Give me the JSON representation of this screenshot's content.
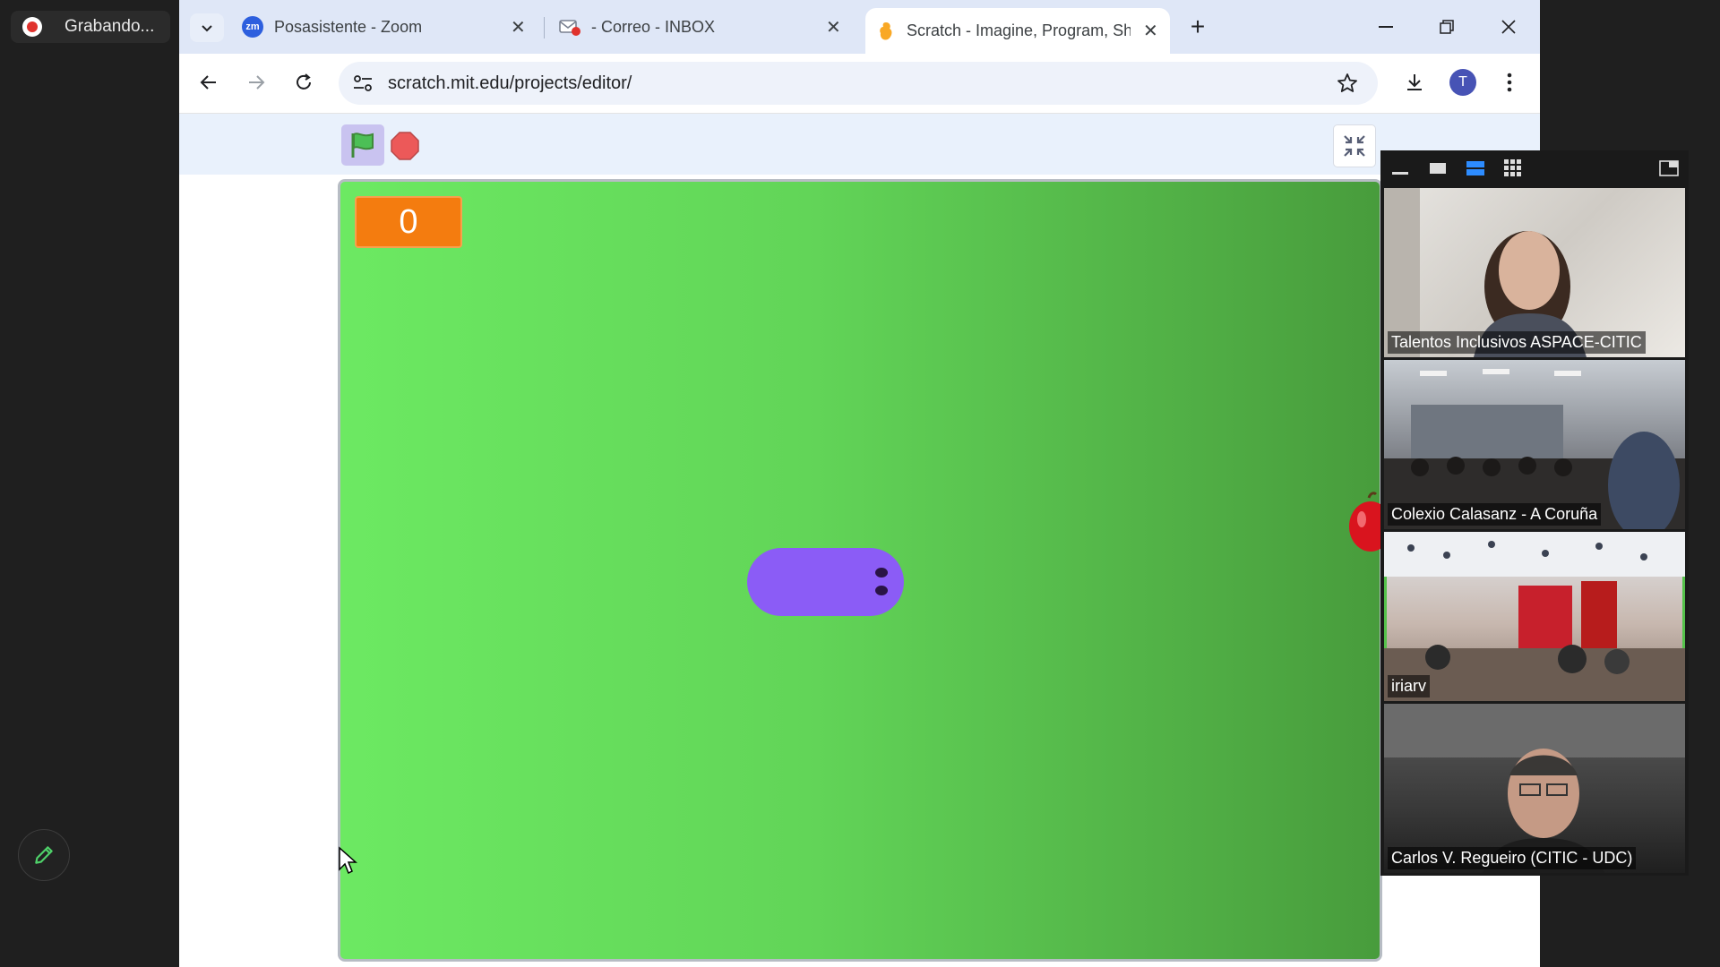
{
  "recording": {
    "label": "Grabando..."
  },
  "browser": {
    "tabs": [
      {
        "title": "Posasistente - Zoom",
        "icon": "zoom-icon",
        "active": false
      },
      {
        "title": "- Correo - INBOX",
        "icon": "mail-icon",
        "active": false
      },
      {
        "title": "Scratch - Imagine, Program, Sha",
        "icon": "scratch-icon",
        "active": true
      }
    ],
    "address": {
      "url": "scratch.mit.edu/projects/editor/"
    },
    "profile_initial": "T"
  },
  "scratch": {
    "score": "0",
    "colors": {
      "stage_green": "#62d558",
      "snake": "#8b5cf6",
      "score_bg": "#f47c0f"
    }
  },
  "zoom": {
    "participants": [
      {
        "name": "Talentos Inclusivos ASPACE-CITIC",
        "speaking": false
      },
      {
        "name": "Colexio Calasanz - A Coruña",
        "speaking": false
      },
      {
        "name": "iriarv",
        "speaking": true
      },
      {
        "name": "Carlos V. Regueiro (CITIC - UDC)",
        "speaking": false
      }
    ]
  }
}
